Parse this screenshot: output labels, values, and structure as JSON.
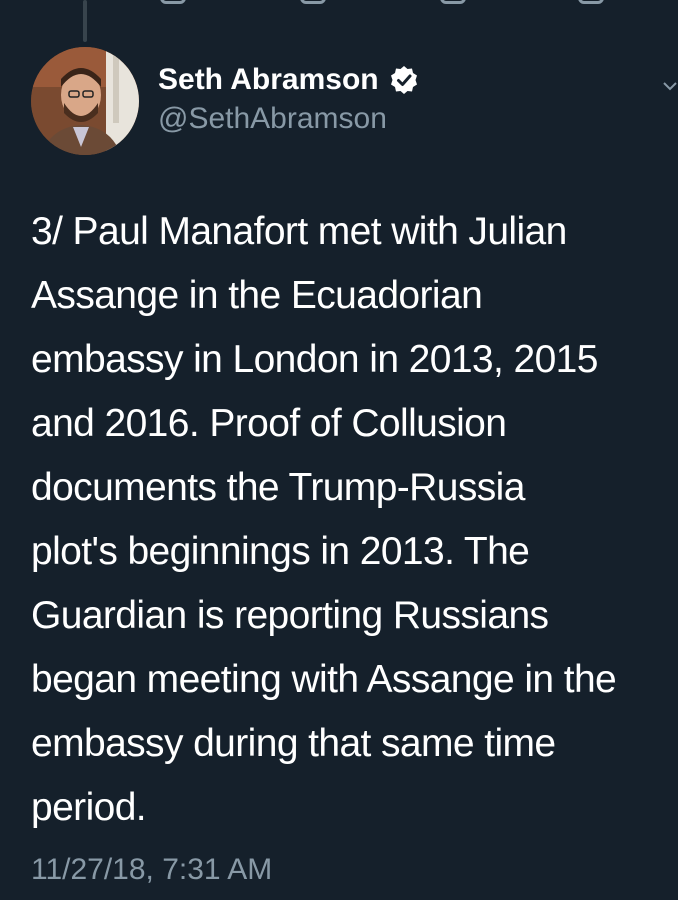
{
  "author": {
    "display_name": "Seth Abramson",
    "handle": "@SethAbramson",
    "verified": true
  },
  "tweet": {
    "lines": [
      "3/ Paul Manafort met with Julian",
      "Assange in the Ecuadorian",
      "embassy in London in 2013, 2015",
      "and 2016. Proof of Collusion",
      "documents the Trump-Russia",
      "plot's beginnings in 2013. The",
      "Guardian is reporting Russians",
      "began meeting with Assange in the",
      "embassy during that same time",
      "period."
    ],
    "timestamp": "11/27/18, 7:31 AM"
  },
  "icons": {
    "verified": "verified-badge-icon",
    "caret": "chevron-down-icon",
    "actions": [
      "reply-icon",
      "retweet-icon",
      "like-icon",
      "share-icon"
    ]
  },
  "colors": {
    "background": "#15202b",
    "primary_text": "#ffffff",
    "secondary_text": "#8899a6",
    "divider": "#38444d"
  }
}
